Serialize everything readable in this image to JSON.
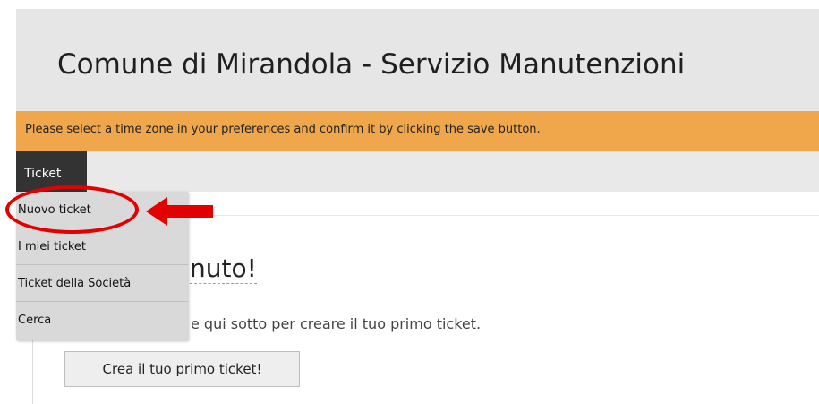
{
  "header": {
    "title": "Comune di Mirandola - Servizio Manutenzioni"
  },
  "notice": {
    "text": "Please select a time zone in your preferences and confirm it by clicking the save button.",
    "color": "#f0a64a"
  },
  "nav": {
    "ticket_label": "Ticket"
  },
  "dropdown": {
    "items": [
      {
        "label": "Nuovo ticket"
      },
      {
        "label": "I miei ticket"
      },
      {
        "label": "Ticket della Società"
      },
      {
        "label": "Cerca"
      }
    ]
  },
  "main": {
    "welcome": "nuto!",
    "subtext": "e qui sotto per creare il tuo primo ticket.",
    "create_button": "Crea il tuo primo ticket!"
  },
  "annotation": {
    "color": "#e30000"
  }
}
